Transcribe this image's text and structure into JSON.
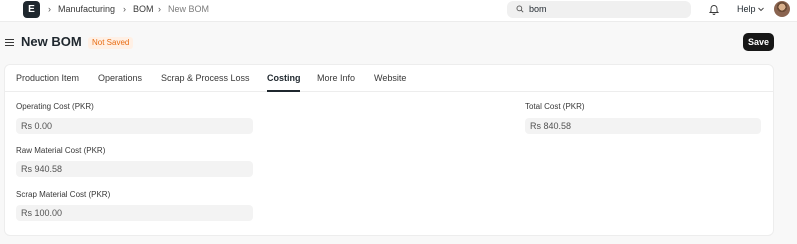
{
  "navbar": {
    "logo_letter": "E",
    "breadcrumbs": [
      "Manufacturing",
      "BOM",
      "New BOM"
    ],
    "search_value": "bom",
    "help_label": "Help"
  },
  "header": {
    "title": "New BOM",
    "status_badge": "Not Saved",
    "save_label": "Save"
  },
  "tabs": [
    "Production Item",
    "Operations",
    "Scrap & Process Loss",
    "Costing",
    "More Info",
    "Website"
  ],
  "active_tab": "Costing",
  "fields": {
    "operating_cost": {
      "label": "Operating Cost (PKR)",
      "value": "Rs 0.00"
    },
    "raw_material_cost": {
      "label": "Raw Material Cost (PKR)",
      "value": "Rs 940.58"
    },
    "scrap_material_cost": {
      "label": "Scrap Material Cost (PKR)",
      "value": "Rs 100.00"
    },
    "total_cost": {
      "label": "Total Cost (PKR)",
      "value": "Rs 840.58"
    }
  },
  "colors": {
    "badge_text": "#e86c13",
    "badge_bg": "#fff0e5",
    "save_bg": "#171717"
  }
}
